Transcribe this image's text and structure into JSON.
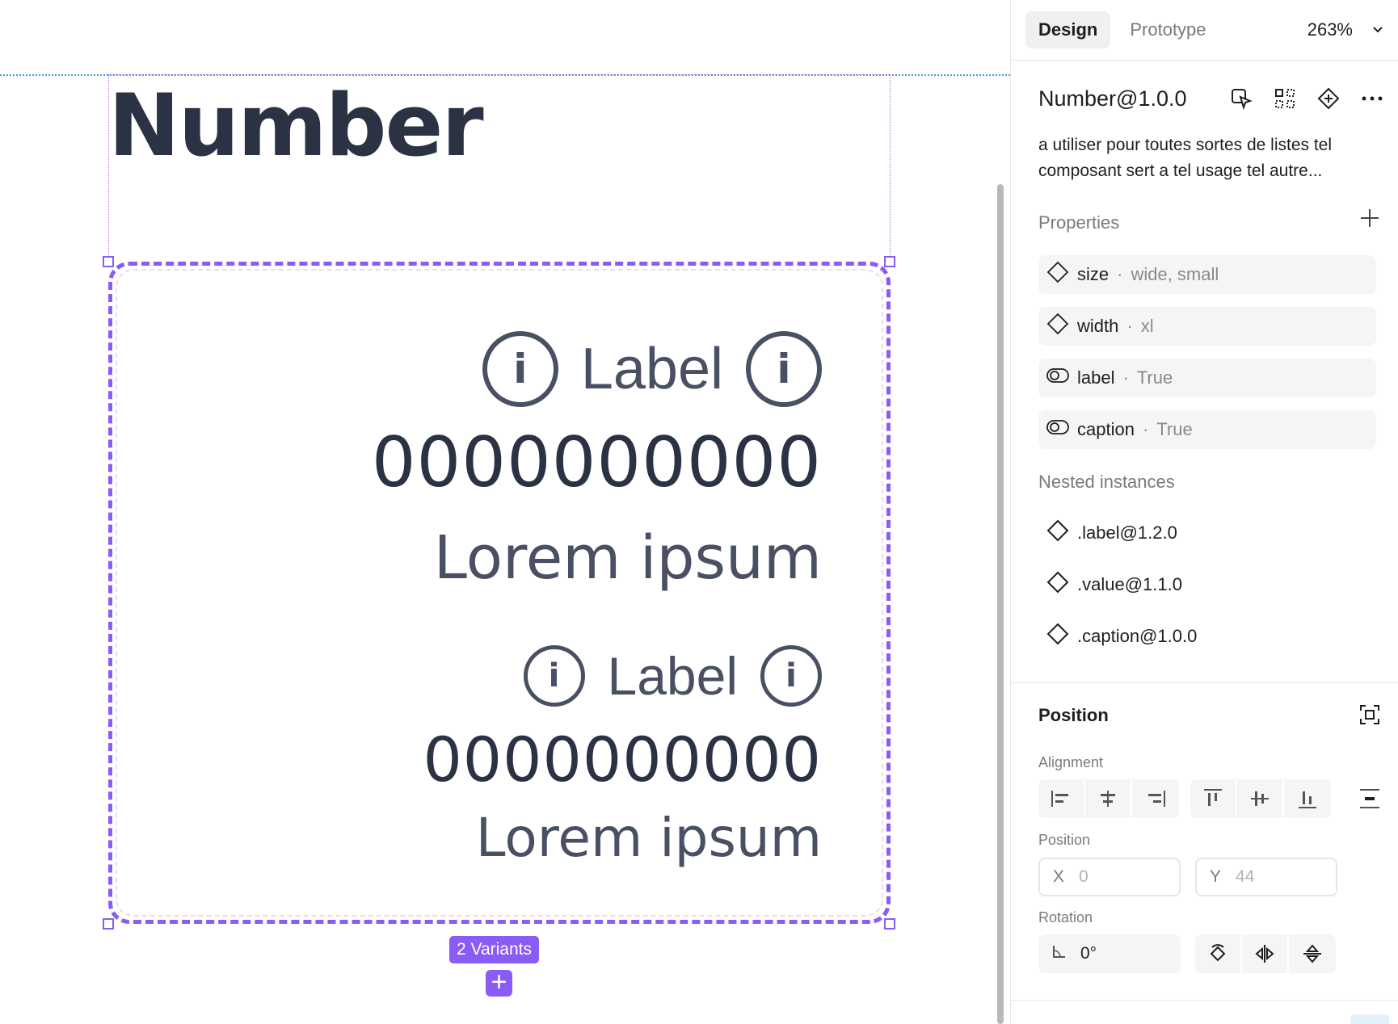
{
  "canvas": {
    "frame_title": "Number",
    "variant1": {
      "label": "Label",
      "value": "0000000000",
      "caption": "Lorem ipsum"
    },
    "variant2": {
      "label": "Label",
      "value": "0000000000",
      "caption": "Lorem ipsum"
    },
    "variants_badge": "2 Variants",
    "add_variant_symbol": "+",
    "info_glyph": "i"
  },
  "panel": {
    "tabs": [
      {
        "label": "Design"
      },
      {
        "label": "Prototype"
      }
    ],
    "zoom": "263%",
    "component": {
      "name": "Number@1.0.0",
      "description": "a utiliser pour toutes sortes de listes tel composant sert a tel usage tel autre..."
    },
    "properties": {
      "title": "Properties",
      "items": [
        {
          "name": "size",
          "sep": "·",
          "value": "wide, small",
          "icon": "variant-diamond-icon"
        },
        {
          "name": "width",
          "sep": "·",
          "value": "xl",
          "icon": "variant-diamond-icon"
        },
        {
          "name": "label",
          "sep": "·",
          "value": "True",
          "icon": "toggle-icon"
        },
        {
          "name": "caption",
          "sep": "·",
          "value": "True",
          "icon": "toggle-icon"
        }
      ]
    },
    "nested": {
      "title": "Nested instances",
      "items": [
        {
          "name": ".label@1.2.0"
        },
        {
          "name": ".value@1.1.0"
        },
        {
          "name": ".caption@1.0.0"
        }
      ]
    },
    "position": {
      "title": "Position",
      "alignment_label": "Alignment",
      "position_label": "Position",
      "x_label": "X",
      "x_value": "0",
      "y_label": "Y",
      "y_value": "44",
      "rotation_label": "Rotation",
      "rotation_value": "0°"
    }
  },
  "colors": {
    "accent": "#8a5cf6",
    "text_dark": "#2a3244",
    "text_mid": "#4a5064"
  }
}
